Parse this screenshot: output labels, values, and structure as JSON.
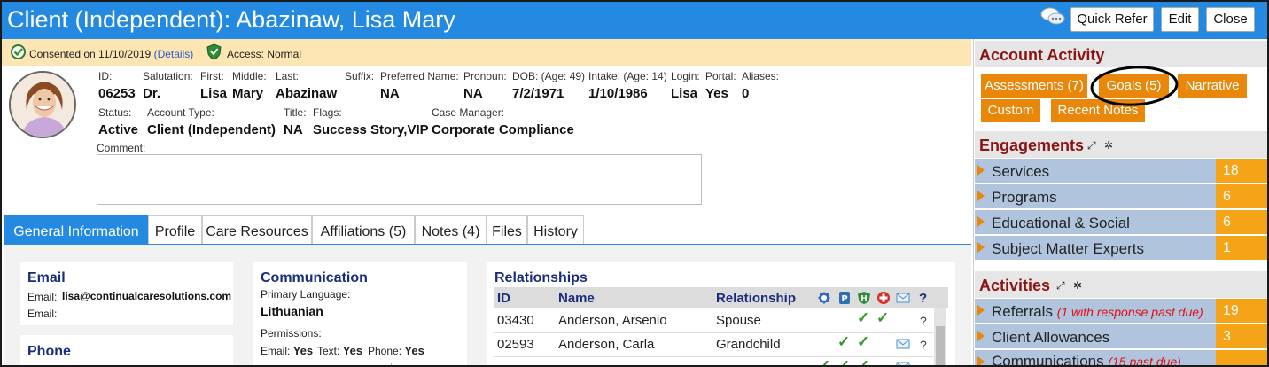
{
  "window": {
    "title": "Client (Independent): Abazinaw, Lisa Mary",
    "quick_refer": "Quick Refer",
    "edit": "Edit",
    "close": "Close"
  },
  "consent": {
    "text": "Consented on 11/10/2019",
    "details_link": "(Details)",
    "access": "Access: Normal"
  },
  "client": {
    "id_label": "ID:",
    "id": "06253",
    "salutation_label": "Salutation:",
    "salutation": "Dr.",
    "first_label": "First:",
    "first": "Lisa",
    "middle_label": "Middle:",
    "middle": "Mary",
    "last_label": "Last:",
    "last": "Abazinaw",
    "suffix_label": "Suffix:",
    "preferred_label": "Preferred Name:",
    "preferred": "NA",
    "pronoun_label": "Pronoun:",
    "pronoun": "NA",
    "dob_label": "DOB: (Age: 49)",
    "dob": "7/2/1971",
    "intake_label": "Intake: (Age: 14)",
    "intake": "1/10/1986",
    "login_label": "Login:",
    "login": "Lisa",
    "portal_label": "Portal:",
    "portal": "Yes",
    "aliases_label": "Aliases:",
    "aliases": "0",
    "status_label": "Status:",
    "status": "Active",
    "account_type_label": "Account Type:",
    "account_type": "Client (Independent)",
    "title_label": "Title:",
    "title": "NA",
    "flags_label": "Flags:",
    "flags": "Success Story,VIP",
    "case_manager_label": "Case Manager:",
    "case_manager": "Corporate Compliance",
    "comment_label": "Comment:"
  },
  "tabs": [
    {
      "label": "General Information"
    },
    {
      "label": "Profile"
    },
    {
      "label": "Care Resources"
    },
    {
      "label": "Affiliations (5)"
    },
    {
      "label": "Notes (4)"
    },
    {
      "label": "Files"
    },
    {
      "label": "History"
    }
  ],
  "email": {
    "heading": "Email",
    "label1": "Email:",
    "value1": "lisa@continualcaresolutions.com",
    "label2": "Email:"
  },
  "phone": {
    "heading": "Phone"
  },
  "communication": {
    "heading": "Communication",
    "language_label": "Primary Language:",
    "language": "Lithuanian",
    "permissions_label": "Permissions:",
    "email_label": "Email:",
    "email_value": "Yes",
    "text_label": "Text:",
    "text_value": "Yes",
    "phone_label": "Phone:",
    "phone_value": "Yes"
  },
  "relationships": {
    "heading": "Relationships",
    "col_id": "ID",
    "col_name": "Name",
    "col_relationship": "Relationship",
    "col_q": "?",
    "rows": [
      {
        "id": "03430",
        "name": "Anderson, Arsenio",
        "relationship": "Spouse",
        "q": "?"
      },
      {
        "id": "02593",
        "name": "Anderson, Carla",
        "relationship": "Grandchild",
        "q": "?"
      }
    ]
  },
  "account_activity": {
    "heading": "Account Activity",
    "buttons": [
      {
        "label": "Assessments (7)"
      },
      {
        "label": "Goals (5)"
      },
      {
        "label": "Narrative"
      },
      {
        "label": "Custom"
      },
      {
        "label": "Recent Notes"
      }
    ]
  },
  "engagements": {
    "heading": "Engagements",
    "items": [
      {
        "label": "Services",
        "count": "18"
      },
      {
        "label": "Programs",
        "count": "6"
      },
      {
        "label": "Educational & Social",
        "count": "6"
      },
      {
        "label": "Subject Matter Experts",
        "count": "1"
      }
    ]
  },
  "activities": {
    "heading": "Activities",
    "items": [
      {
        "label": "Referrals",
        "note": "(1 with response past due)",
        "count": "19"
      },
      {
        "label": "Client Allowances",
        "note": "",
        "count": "3"
      },
      {
        "label": "Communications",
        "note": "(15 past due)",
        "count": ""
      }
    ]
  },
  "colors": {
    "title_bar": "#2489e0",
    "consent_bar": "#fde6b4",
    "orange": "#e8870a",
    "count_bg": "#f5a418",
    "row_bg": "#b0c4de",
    "section_title": "#8b1414",
    "heading_blue": "#1a2d7a"
  }
}
